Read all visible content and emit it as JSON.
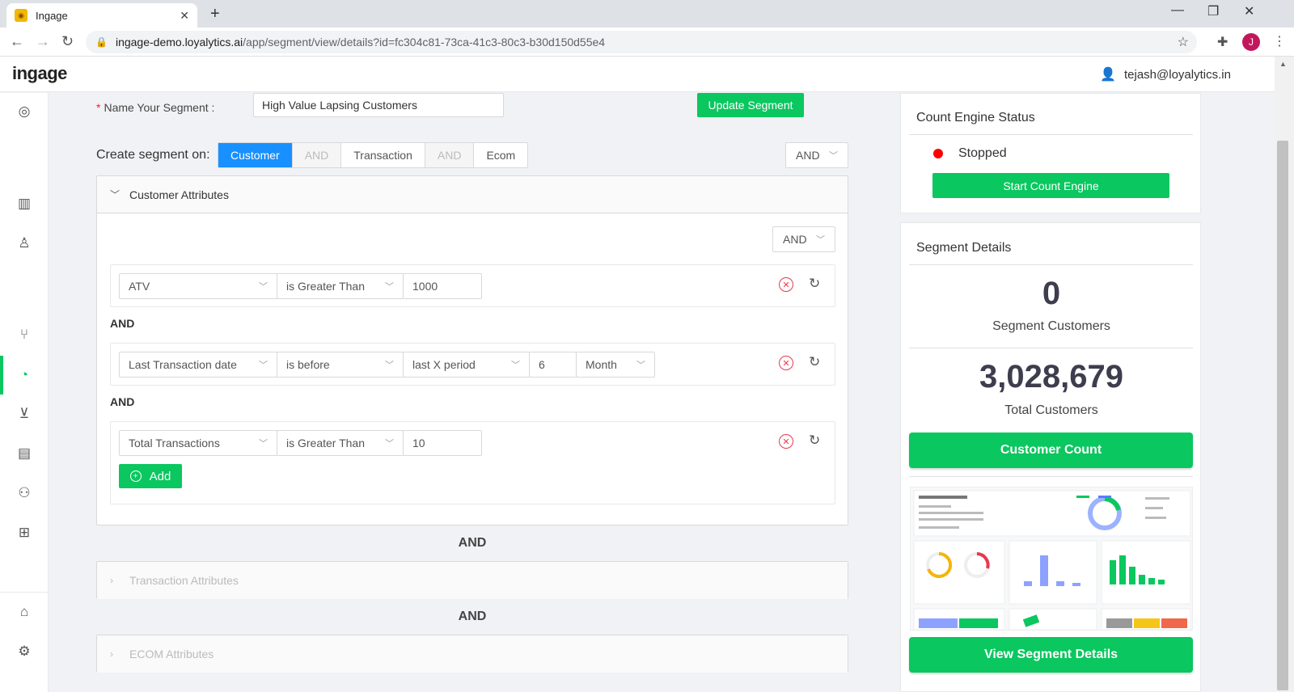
{
  "browser": {
    "tab_title": "Ingage",
    "url_host": "ingage-demo.loyalytics.ai",
    "url_path": "/app/segment/view/details?id=fc304c81-73ca-41c3-80c3-b30d150d55e4",
    "profile_initial": "J"
  },
  "header": {
    "logo": "ingage",
    "user_email": "tejash@loyalytics.in"
  },
  "segment": {
    "name_label": "Name Your Segment",
    "name_value": "High Value Lapsing Customers",
    "update_label": "Update Segment",
    "create_on_label": "Create segment on:",
    "create_on_options": [
      "Customer",
      "AND",
      "Transaction",
      "AND",
      "Ecom"
    ],
    "top_operator": "AND"
  },
  "customer_attributes": {
    "title": "Customer Attributes",
    "operator": "AND",
    "conditions": [
      {
        "field": "ATV",
        "op": "is Greater Than",
        "value": "1000"
      },
      {
        "field": "Last Transaction date",
        "op": "is before",
        "period": "last X period",
        "value": "6",
        "unit": "Month"
      },
      {
        "field": "Total Transactions",
        "op": "is Greater Than",
        "value": "10"
      }
    ],
    "joiner": "AND",
    "add_label": "Add"
  },
  "between_and": "AND",
  "transaction_attributes": {
    "title": "Transaction Attributes"
  },
  "ecom_attributes": {
    "title": "ECOM Attributes"
  },
  "count_engine": {
    "title": "Count Engine Status",
    "status": "Stopped",
    "status_color": "#ff0000",
    "start_label": "Start Count Engine"
  },
  "segment_details": {
    "title": "Segment Details",
    "segment_customers": "0",
    "segment_customers_label": "Segment Customers",
    "total_customers": "3,028,679",
    "total_customers_label": "Total Customers",
    "customer_count_label": "Customer Count",
    "view_details_label": "View Segment Details"
  },
  "colors": {
    "accent_green": "#0ac75f",
    "accent_blue": "#1890ff",
    "danger": "#e8384f"
  }
}
